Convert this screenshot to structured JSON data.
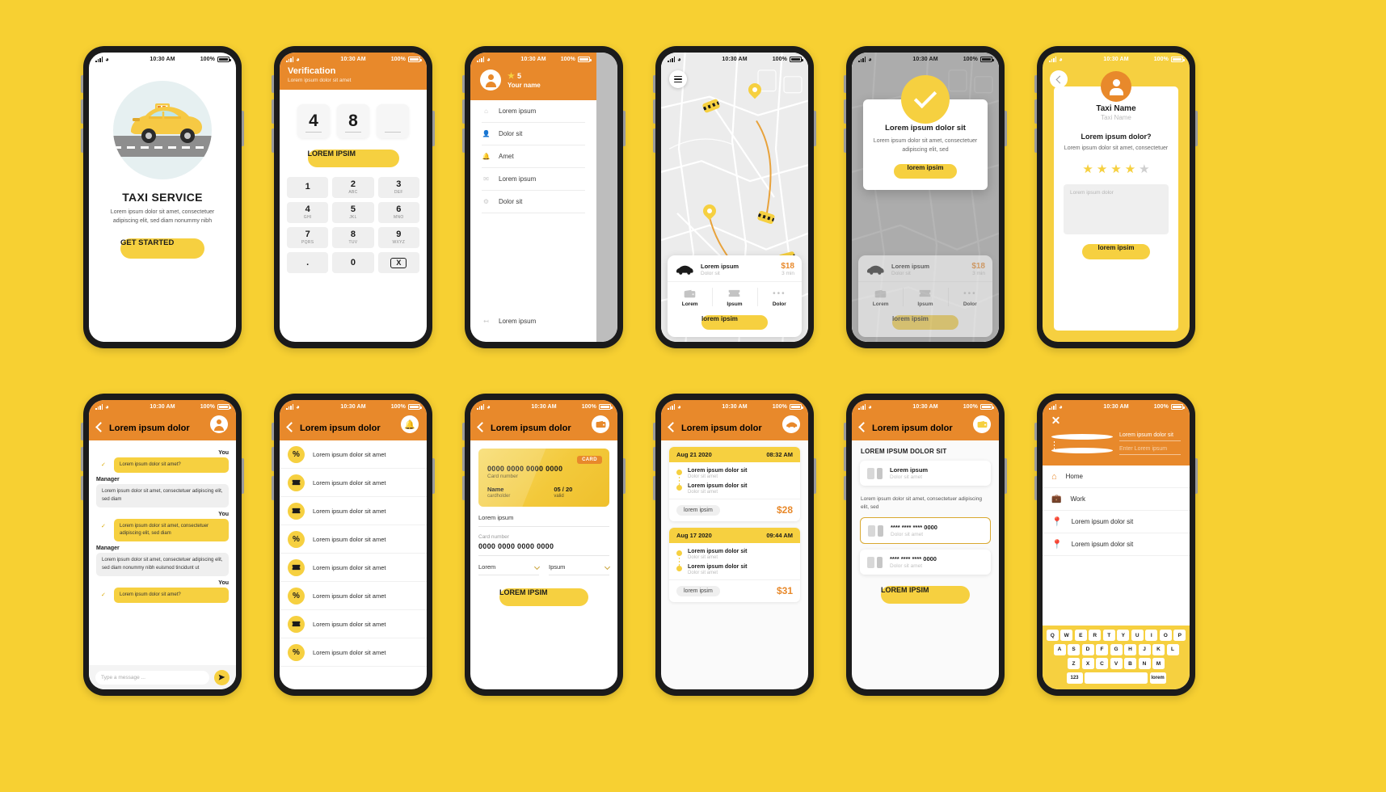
{
  "meta": {
    "brand_yellow": "#F6D040",
    "brand_orange": "#E8892B",
    "bg": "#F7D032"
  },
  "status_bar": {
    "time": "10:30 AM",
    "battery": "100%"
  },
  "screens": {
    "onboarding": {
      "title": "TAXI SERVICE",
      "description": "Lorem ipsum dolor sit amet, consectetuer adipiscing elit, sed diam nonummy nibh",
      "cta": "GET STARTED"
    },
    "verification": {
      "title": "Verification",
      "subtitle": "Lorem ipsum dolor sit amet",
      "otp": [
        "4",
        "8",
        ""
      ],
      "cta": "LOREM IPSIM",
      "keys": [
        {
          "digit": "1",
          "letters": ""
        },
        {
          "digit": "2",
          "letters": "ABC"
        },
        {
          "digit": "3",
          "letters": "DEF"
        },
        {
          "digit": "4",
          "letters": "GHI"
        },
        {
          "digit": "5",
          "letters": "JKL"
        },
        {
          "digit": "6",
          "letters": "MNO"
        },
        {
          "digit": "7",
          "letters": "PQRS"
        },
        {
          "digit": "8",
          "letters": "TUV"
        },
        {
          "digit": "9",
          "letters": "WXYZ"
        },
        {
          "digit": ".",
          "letters": ""
        },
        {
          "digit": "0",
          "letters": ""
        },
        {
          "digit": "X",
          "letters": ""
        }
      ]
    },
    "menu": {
      "rating": "5",
      "user_name": "Your name",
      "items": [
        "Lorem ipsum",
        "Dolor sit",
        "Amet",
        "Lorem ipsum",
        "Dolor sit"
      ],
      "logout": "Lorem ipsum"
    },
    "map": {
      "ride_title": "Lorem ipsum",
      "ride_sub": "Dolor sit",
      "price": "$18",
      "eta": "3 min",
      "tabs": [
        "Lorem",
        "Ipsum",
        "Dolor"
      ],
      "cta": "lorem ipsim"
    },
    "confirm": {
      "title": "Lorem ipsum dolor sit",
      "description": "Lorem ipsum dolor sit amet, consectetuer adipiscing elit, sed",
      "cta": "lorem ipsim",
      "ride_title": "Lorem ipsum",
      "ride_sub": "Dolor sit",
      "price": "$18",
      "eta": "3 min",
      "tabs": [
        "Lorem",
        "Ipsum",
        "Dolor"
      ],
      "bottom_cta": "lorem ipsim"
    },
    "rating": {
      "driver_name": "Taxi Name",
      "driver_sub": "Taxi Name",
      "question": "Lorem ipsum dolor?",
      "description": "Lorem ipsum dolor sit amet, consectetuer",
      "stars_filled": 4,
      "stars_total": 5,
      "comment_placeholder": "Lorem ipsum dolor",
      "cta": "lorem ipsim"
    },
    "chat": {
      "title": "Lorem ipsum dolor",
      "me_label": "You",
      "them_label": "Manager",
      "messages": [
        {
          "from": "me",
          "text": "Lorem ipsum dolor sit amet?"
        },
        {
          "from": "them",
          "text": "Lorem ipsum dolor sit amet, consectetuer adipiscing elit, sed diam"
        },
        {
          "from": "me",
          "text": "Lorem ipsum dolor sit amet, consectetuer adipiscing elit, sed diam"
        },
        {
          "from": "them",
          "text": "Lorem ipsum dolor sit amet, consectetuer adipiscing elit, sed diam nonummy nibh euismod tincidunt ut"
        },
        {
          "from": "me",
          "text": "Lorem ipsum dolor sit amet?"
        }
      ],
      "input_placeholder": "Type a message ..."
    },
    "promos": {
      "title": "Lorem ipsum dolor",
      "items": [
        {
          "icon": "%",
          "text": "Lorem ipsum dolor sit amet"
        },
        {
          "icon": "ticket",
          "text": "Lorem ipsum dolor sit amet"
        },
        {
          "icon": "ticket",
          "text": "Lorem ipsum dolor sit amet"
        },
        {
          "icon": "%",
          "text": "Lorem ipsum dolor sit amet"
        },
        {
          "icon": "ticket",
          "text": "Lorem ipsum dolor sit amet"
        },
        {
          "icon": "%",
          "text": "Lorem ipsum dolor sit amet"
        },
        {
          "icon": "ticket",
          "text": "Lorem ipsum dolor sit amet"
        },
        {
          "icon": "%",
          "text": "Lorem ipsum dolor sit amet"
        }
      ]
    },
    "card": {
      "title": "Lorem ipsum dolor",
      "badge": "CARD",
      "card_number_display": "0000 0000 0000 0000",
      "card_number_caption": "Card number",
      "holder_name": "Name",
      "holder_caption": "cardholder",
      "expiry": "05 / 20",
      "expiry_caption": "valid",
      "field_name_value": "Lorem ipsum",
      "field_number_caption": "Card number",
      "field_number_value": "0000 0000 0000 0000",
      "select_left": "Lorem",
      "select_right": "Ipsum",
      "cta": "LOREM IPSIM"
    },
    "history": {
      "title": "Lorem ipsum dolor",
      "trips": [
        {
          "date": "Aug 21 2020",
          "time": "08:32 AM",
          "from": "Lorem ipsum dolor sit",
          "from_sub": "Dolor sit amet",
          "to": "Lorem ipsum dolor sit",
          "to_sub": "Dolor sit amet",
          "action": "lorem ipsim",
          "amount": "$28"
        },
        {
          "date": "Aug 17 2020",
          "time": "09:44 AM",
          "from": "Lorem ipsum dolor sit",
          "from_sub": "Dolor sit amet",
          "to": "Lorem ipsum dolor sit",
          "to_sub": "Dolor sit amet",
          "action": "lorem ipsim",
          "amount": "$31"
        }
      ]
    },
    "payment": {
      "title": "Lorem ipsum dolor",
      "section_title": "LOREM IPSUM DOLOR SIT",
      "primary": {
        "name": "Lorem ipsum",
        "sub": "Dolor sit amet"
      },
      "note": "Lorem ipsum dolor sit amet, consectetuer adipiscing elit, sed",
      "cards": [
        {
          "name": "**** **** **** 0000",
          "sub": "Dolor sit amet",
          "selected": true
        },
        {
          "name": "**** **** **** 0000",
          "sub": "Dolor sit amet",
          "selected": false
        }
      ],
      "cta": "LOREM IPSIM"
    },
    "address": {
      "pickup": "Lorem ipsum dolor sit",
      "destination_placeholder": "Enter Lorem ipsum",
      "shortcuts": [
        {
          "icon": "home-icon",
          "label": "Home"
        },
        {
          "icon": "work-icon",
          "label": "Work"
        },
        {
          "icon": "pin-icon",
          "label": "Lorem ipsum dolor sit"
        },
        {
          "icon": "pin-icon",
          "label": "Lorem ipsum dolor sit"
        }
      ],
      "keyboard": {
        "row1": [
          "Q",
          "W",
          "E",
          "R",
          "T",
          "Y",
          "U",
          "I",
          "O",
          "P"
        ],
        "row2": [
          "A",
          "S",
          "D",
          "F",
          "G",
          "H",
          "J",
          "K",
          "L"
        ],
        "row3": [
          "Z",
          "X",
          "C",
          "V",
          "B",
          "N",
          "M"
        ],
        "numeric_key": "123",
        "space_key": "lorem"
      }
    }
  }
}
